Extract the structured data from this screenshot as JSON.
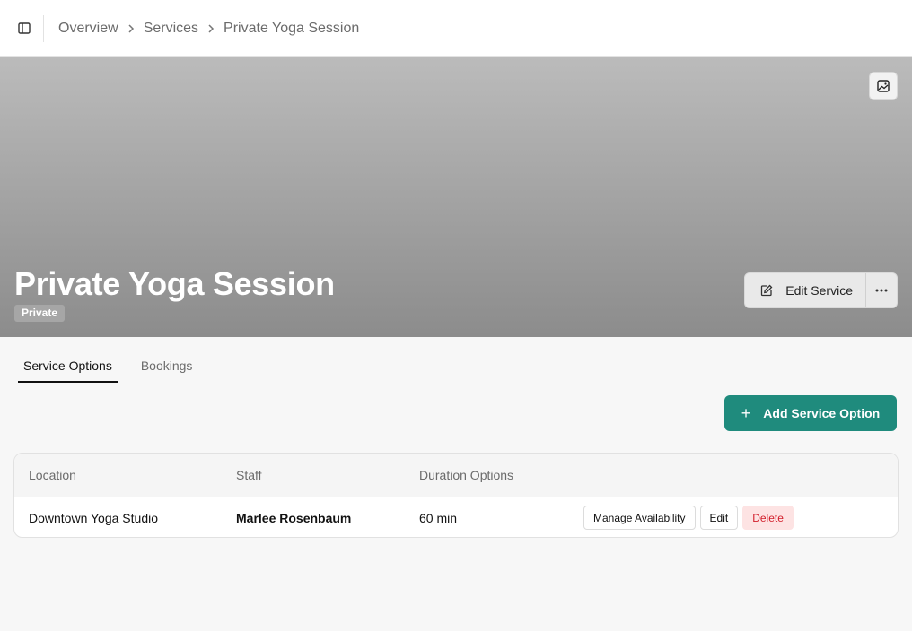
{
  "breadcrumb": {
    "items": [
      "Overview",
      "Services",
      "Private Yoga Session"
    ]
  },
  "hero": {
    "title": "Private Yoga Session",
    "badge": "Private",
    "edit_label": "Edit Service"
  },
  "tabs": [
    {
      "label": "Service Options",
      "active": true
    },
    {
      "label": "Bookings",
      "active": false
    }
  ],
  "add_button_label": "Add Service Option",
  "table": {
    "headers": [
      "Location",
      "Staff",
      "Duration Options"
    ],
    "rows": [
      {
        "location": "Downtown Yoga Studio",
        "staff": "Marlee Rosenbaum",
        "duration": "60 min",
        "actions": [
          "Manage Availability",
          "Edit",
          "Delete"
        ]
      }
    ]
  },
  "colors": {
    "accent": "#1f8b7d",
    "danger": "#d21f2b",
    "danger_bg": "#fde3e3"
  },
  "icons": [
    "sidebar-toggle-icon",
    "chevron-right-icon",
    "image-icon",
    "edit-icon",
    "more-horizontal-icon",
    "plus-icon"
  ]
}
